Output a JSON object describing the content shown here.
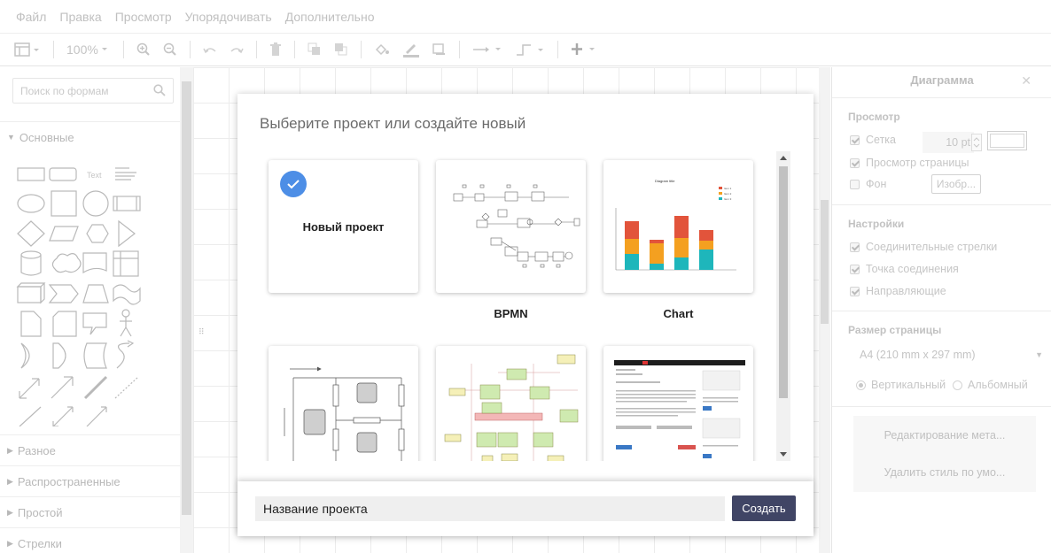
{
  "menubar": {
    "items": [
      "Файл",
      "Правка",
      "Просмотр",
      "Упорядочивать",
      "Дополнительно"
    ]
  },
  "toolbar": {
    "zoom": "100%"
  },
  "left_panel": {
    "search_placeholder": "Поиск по формам",
    "sections": [
      {
        "label": "Основные",
        "expanded": true
      },
      {
        "label": "Разное",
        "expanded": false
      },
      {
        "label": "Распространенные",
        "expanded": false
      },
      {
        "label": "Простой",
        "expanded": false
      },
      {
        "label": "Стрелки",
        "expanded": false
      }
    ],
    "text_shape_label": "Text"
  },
  "right_panel": {
    "title": "Диаграмма",
    "view_section": "Просмотр",
    "grid_label": "Сетка",
    "grid_size": "10 pt",
    "page_view_label": "Просмотр страницы",
    "background_label": "Фон",
    "image_button": "Изобр...",
    "settings_section": "Настройки",
    "connection_arrows": "Соединительные стрелки",
    "connection_point": "Точка соединения",
    "guides": "Направляющие",
    "page_size_section": "Размер страницы",
    "page_size_value": "A4 (210 mm x 297 mm)",
    "portrait": "Вертикальный",
    "landscape": "Альбомный",
    "edit_meta": "Редактирование мета...",
    "remove_style": "Удалить стиль по умо..."
  },
  "dialog": {
    "title": "Выберите проект или создайте новый",
    "templates": [
      {
        "label": "Новый проект",
        "selected": true
      },
      {
        "label": "BPMN"
      },
      {
        "label": "Chart"
      },
      {
        "label": ""
      },
      {
        "label": ""
      },
      {
        "label": ""
      }
    ],
    "name_value": "Название проекта",
    "create_label": "Создать"
  },
  "chart_preview": {
    "title": "Diagram title",
    "legend": [
      "Item 1",
      "Item 2",
      "Item 3"
    ],
    "colors": {
      "red": "#e2543b",
      "orange": "#f4a020",
      "teal": "#1eb6bb"
    }
  },
  "colors": {
    "accent": "#4d8ee6",
    "primary_button": "#404565"
  }
}
